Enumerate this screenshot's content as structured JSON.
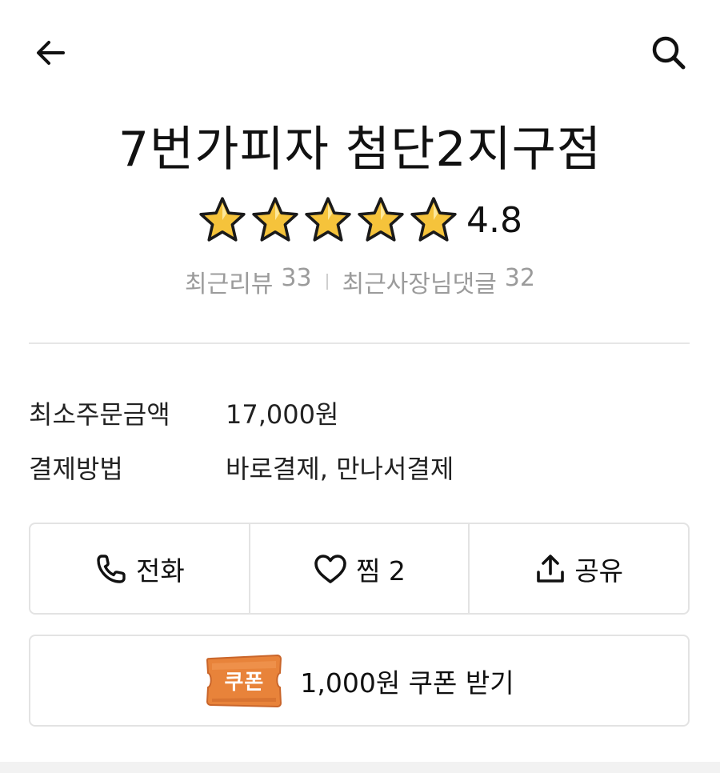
{
  "header": {
    "back_icon": "arrow-left-icon",
    "search_icon": "search-icon"
  },
  "store": {
    "name": "7번가피자 첨단2지구점",
    "rating": "4.8",
    "star_count": 5,
    "star_color": "#f5c33b"
  },
  "reviews": {
    "recent_reviews_label": "최근리뷰",
    "recent_reviews_count": "33",
    "owner_replies_label": "최근사장님댓글",
    "owner_replies_count": "32"
  },
  "info": {
    "min_order_label": "최소주문금액",
    "min_order_value": "17,000원",
    "payment_label": "결제방법",
    "payment_value": "바로결제, 만나서결제"
  },
  "actions": {
    "call_label": "전화",
    "call_icon": "phone-icon",
    "favorite_label": "찜 2",
    "favorite_icon": "heart-icon",
    "share_label": "공유",
    "share_icon": "share-icon"
  },
  "coupon": {
    "badge_label": "쿠폰",
    "badge_color": "#e8833a",
    "text": "1,000원 쿠폰 받기"
  }
}
